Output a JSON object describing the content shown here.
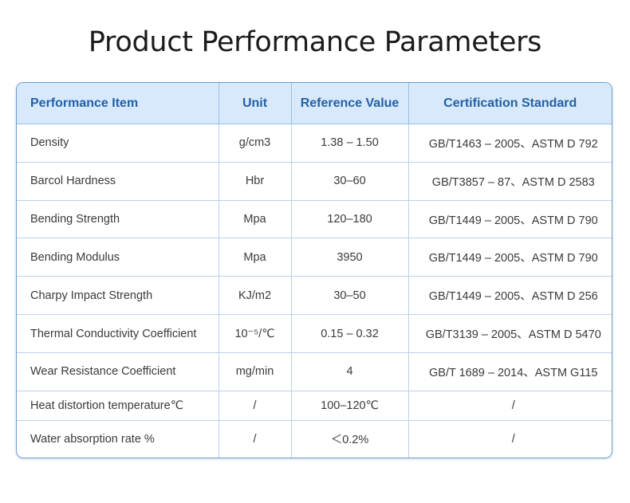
{
  "title": "Product Performance Parameters",
  "table": {
    "headers": [
      "Performance Item",
      "Unit",
      "Reference Value",
      "Certification Standard"
    ],
    "rows": [
      [
        "Density",
        "g/cm3",
        "1.38 – 1.50",
        "GB/T1463 – 2005、ASTM D 792"
      ],
      [
        "Barcol Hardness",
        "Hbr",
        "30–60",
        "GB/T3857 – 87、ASTM D 2583"
      ],
      [
        "Bending Strength",
        "Mpa",
        "120–180",
        "GB/T1449 – 2005、ASTM D 790"
      ],
      [
        "Bending Modulus",
        "Mpa",
        "3950",
        "GB/T1449 – 2005、ASTM D 790"
      ],
      [
        "Charpy Impact Strength",
        "KJ/m2",
        "30–50",
        "GB/T1449 – 2005、ASTM D 256"
      ],
      [
        "Thermal Conductivity Coefficient",
        "10⁻⁵/℃",
        "0.15 – 0.32",
        "GB/T3139 – 2005、ASTM D 5470"
      ],
      [
        "Wear Resistance Coefficient",
        "mg/min",
        "4",
        "GB/T 1689 – 2014、ASTM G115"
      ],
      [
        "Heat distortion temperature℃",
        "/",
        "100–120℃",
        "/"
      ],
      [
        "Water absorption rate %",
        "/",
        "＜0.2%",
        "/"
      ]
    ]
  }
}
